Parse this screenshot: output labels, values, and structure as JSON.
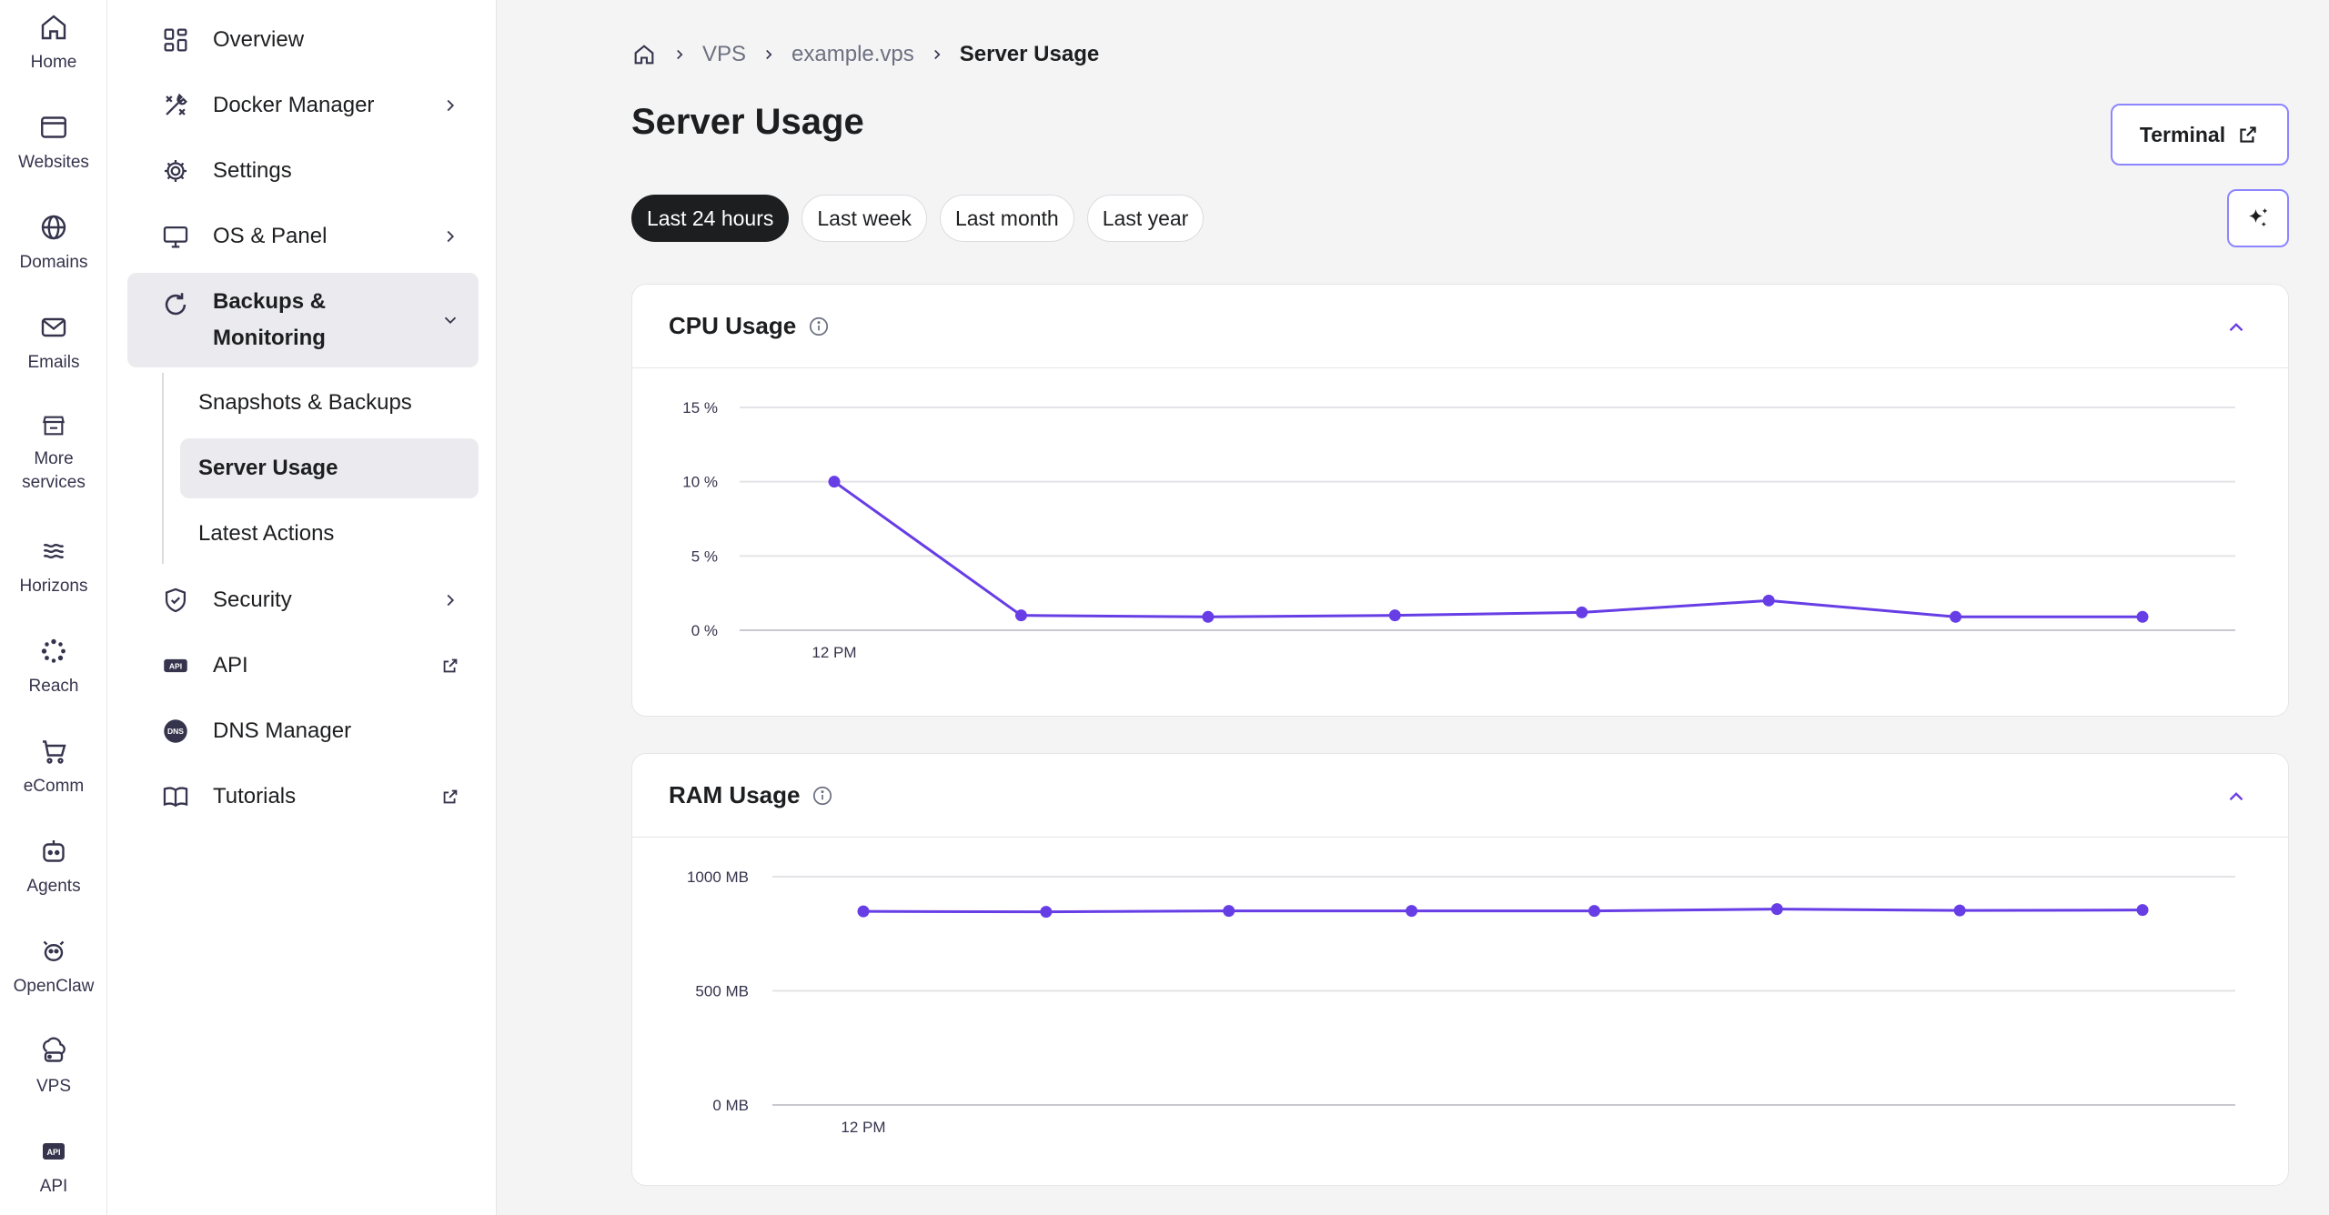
{
  "rail": [
    {
      "label": "Home",
      "icon": "home-icon"
    },
    {
      "label": "Websites",
      "icon": "browser-window-icon"
    },
    {
      "label": "Domains",
      "icon": "globe-icon"
    },
    {
      "label": "Emails",
      "icon": "envelope-icon"
    },
    {
      "label": "More services",
      "icon": "store-icon"
    },
    {
      "label": "Horizons",
      "icon": "waves-icon"
    },
    {
      "label": "Reach",
      "icon": "reach-icon"
    },
    {
      "label": "eComm",
      "icon": "cart-icon"
    },
    {
      "label": "Agents",
      "icon": "robot-icon"
    },
    {
      "label": "OpenClaw",
      "icon": "openclaw-icon"
    },
    {
      "label": "VPS",
      "icon": "cloud-server-icon"
    },
    {
      "label": "API",
      "icon": "api-icon"
    }
  ],
  "sidebar": {
    "items": [
      {
        "label": "Overview"
      },
      {
        "label": "Docker Manager"
      },
      {
        "label": "Settings"
      },
      {
        "label": "OS & Panel"
      },
      {
        "label": "Backups & Monitoring"
      },
      {
        "label": "Security"
      },
      {
        "label": "API"
      },
      {
        "label": "DNS Manager"
      },
      {
        "label": "Tutorials"
      }
    ],
    "sub_items": [
      {
        "label": "Snapshots & Backups"
      },
      {
        "label": "Server Usage"
      },
      {
        "label": "Latest Actions"
      }
    ]
  },
  "breadcrumb": [
    "VPS",
    "example.vps",
    "Server Usage"
  ],
  "page": {
    "title": "Server Usage",
    "terminal_label": "Terminal",
    "filters": [
      "Last 24 hours",
      "Last week",
      "Last month",
      "Last year"
    ],
    "active_filter": "Last 24 hours"
  },
  "colors": {
    "accent": "#673de6",
    "accent_border": "#8c85ff",
    "dark": "#1d1e20"
  },
  "chart_data": [
    {
      "type": "line",
      "title": "CPU Usage",
      "y_unit": "%",
      "ylim": [
        0,
        15
      ],
      "yticks": [
        "0 %",
        "5 %",
        "10 %",
        "15 %"
      ],
      "xticks": [
        "12 PM"
      ],
      "grid": true,
      "series": [
        {
          "values": [
            10,
            1,
            0.9,
            1,
            1.2,
            2,
            0.9,
            0.9
          ]
        }
      ]
    },
    {
      "type": "line",
      "title": "RAM Usage",
      "y_unit": "MB",
      "ylim": [
        0,
        1000
      ],
      "yticks": [
        "0 MB",
        "500 MB",
        "1000 MB"
      ],
      "xticks": [
        "12 PM"
      ],
      "grid": true,
      "series": [
        {
          "values": [
            848,
            846,
            850,
            850,
            850,
            858,
            852,
            854
          ]
        }
      ]
    }
  ]
}
